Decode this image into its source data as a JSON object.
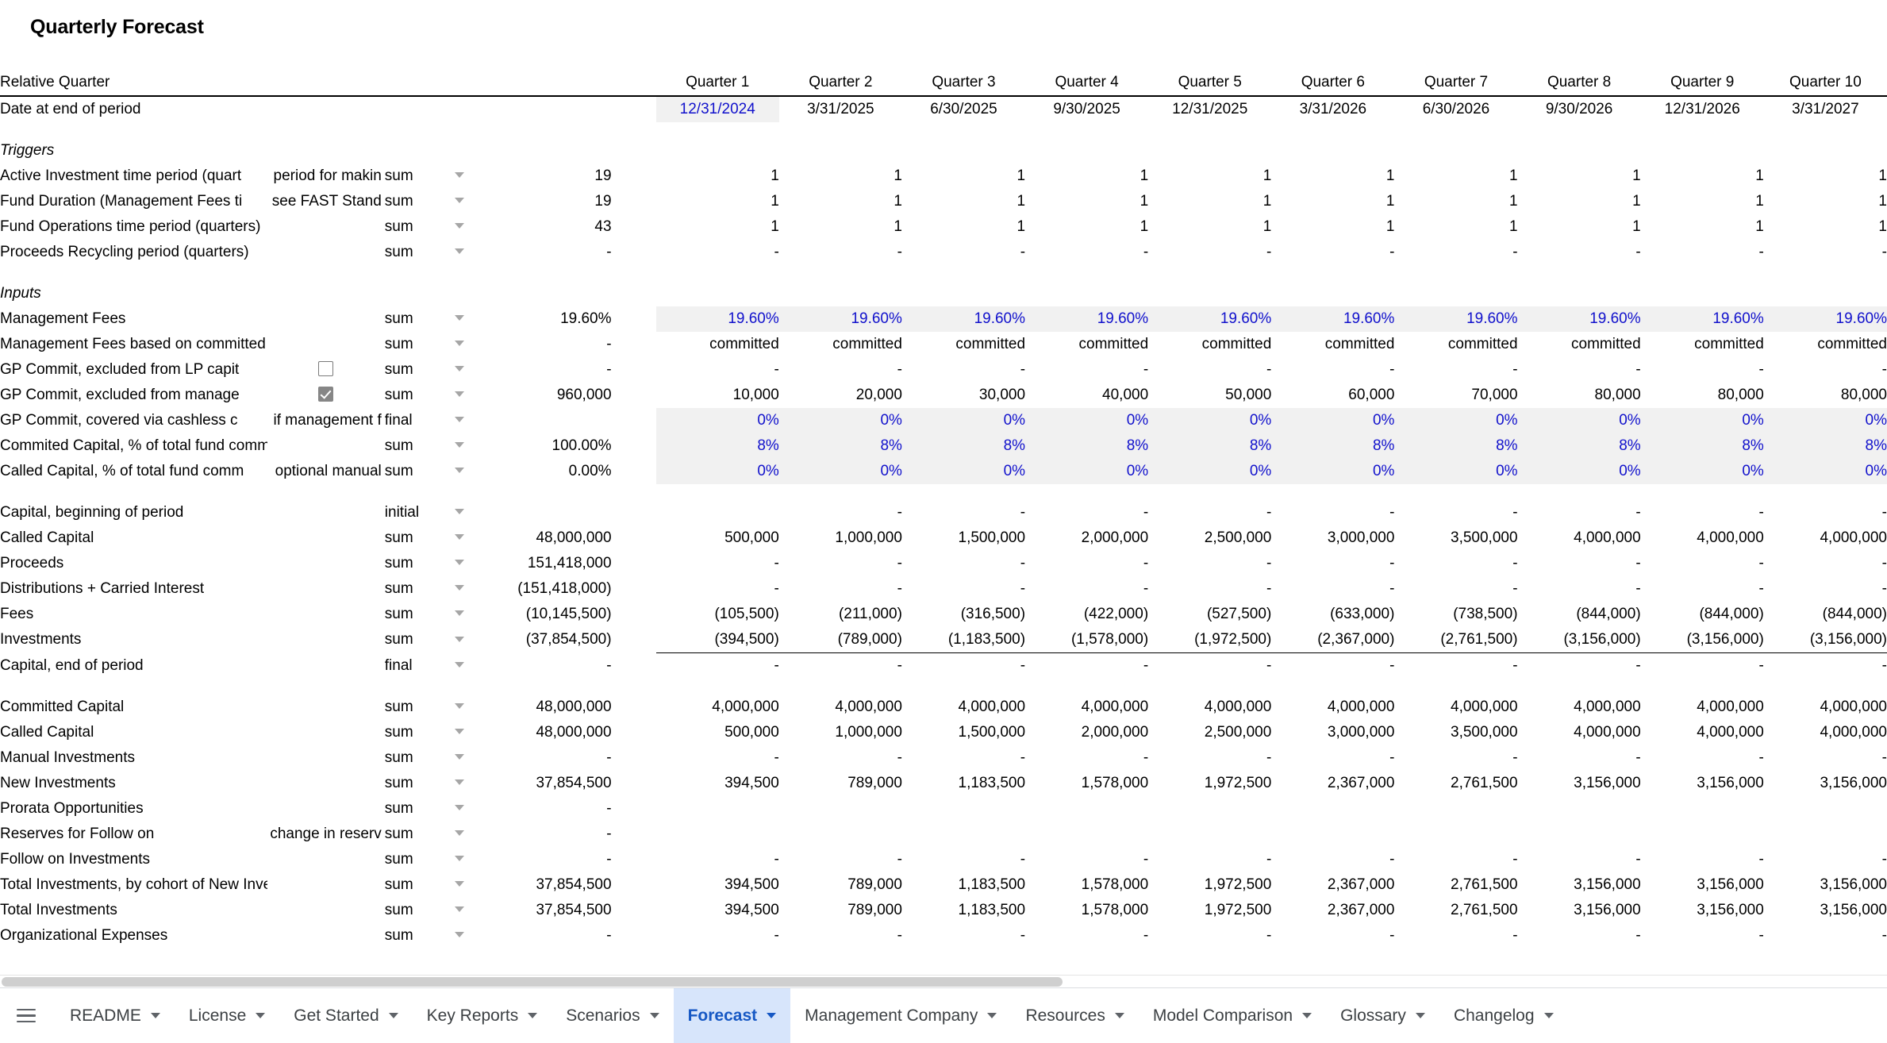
{
  "title": "Quarterly Forecast",
  "columns": {
    "relative_quarter_label": "Relative Quarter",
    "headers": [
      "Quarter 1",
      "Quarter 2",
      "Quarter 3",
      "Quarter 4",
      "Quarter 5",
      "Quarter 6",
      "Quarter 7",
      "Quarter 8",
      "Quarter 9",
      "Quarter 10"
    ]
  },
  "date_row": {
    "label": "Date at end of period",
    "values": [
      "12/31/2024",
      "3/31/2025",
      "6/30/2025",
      "9/30/2025",
      "12/31/2025",
      "3/31/2026",
      "6/30/2026",
      "9/30/2026",
      "12/31/2026",
      "3/31/2027"
    ]
  },
  "sections": {
    "triggers": "Triggers",
    "inputs": "Inputs"
  },
  "rows": {
    "active_investment": {
      "label": "Active Investment time period (quart",
      "note": "period for makin",
      "agg": "sum",
      "total": "19",
      "values": [
        "1",
        "1",
        "1",
        "1",
        "1",
        "1",
        "1",
        "1",
        "1",
        "1"
      ]
    },
    "fund_duration": {
      "label": "Fund Duration (Management Fees ti",
      "note": "see FAST Stand",
      "agg": "sum",
      "total": "19",
      "values": [
        "1",
        "1",
        "1",
        "1",
        "1",
        "1",
        "1",
        "1",
        "1",
        "1"
      ]
    },
    "fund_operations": {
      "label": "Fund Operations time period (quarters)",
      "note": "",
      "agg": "sum",
      "total": "43",
      "values": [
        "1",
        "1",
        "1",
        "1",
        "1",
        "1",
        "1",
        "1",
        "1",
        "1"
      ]
    },
    "proceeds_recycling": {
      "label": "Proceeds Recycling period (quarters)",
      "note": "",
      "agg": "sum",
      "total": "-",
      "values": [
        "-",
        "-",
        "-",
        "-",
        "-",
        "-",
        "-",
        "-",
        "-",
        "-"
      ]
    },
    "management_fees": {
      "label": "Management Fees",
      "note": "",
      "agg": "sum",
      "total": "19.60%",
      "values": [
        "19.60%",
        "19.60%",
        "19.60%",
        "19.60%",
        "19.60%",
        "19.60%",
        "19.60%",
        "19.60%",
        "19.60%",
        "19.60%"
      ]
    },
    "mgmt_fees_basis": {
      "label": "Management Fees based on committed capital. By st",
      "note": "",
      "agg": "sum",
      "total": "-",
      "values": [
        "committed",
        "committed",
        "committed",
        "committed",
        "committed",
        "committed",
        "committed",
        "committed",
        "committed",
        "committed"
      ]
    },
    "gp_commit_lp": {
      "label": "GP Commit, excluded from LP capit",
      "note": "",
      "checkbox": false,
      "agg": "sum",
      "total": "-",
      "values": [
        "-",
        "-",
        "-",
        "-",
        "-",
        "-",
        "-",
        "-",
        "-",
        "-"
      ]
    },
    "gp_commit_mgmt": {
      "label": "GP Commit, excluded from manage",
      "note": "",
      "checkbox": true,
      "agg": "sum",
      "total": "960,000",
      "values": [
        "10,000",
        "20,000",
        "30,000",
        "40,000",
        "50,000",
        "60,000",
        "70,000",
        "80,000",
        "80,000",
        "80,000"
      ]
    },
    "gp_commit_cashless": {
      "label": "GP Commit, covered via cashless c",
      "note": "if management f",
      "agg": "final",
      "total": "",
      "values": [
        "0%",
        "0%",
        "0%",
        "0%",
        "0%",
        "0%",
        "0%",
        "0%",
        "0%",
        "0%"
      ]
    },
    "committed_pct": {
      "label": "Commited Capital, % of total fund committed per yea",
      "note": "",
      "agg": "sum",
      "total": "100.00%",
      "values": [
        "8%",
        "8%",
        "8%",
        "8%",
        "8%",
        "8%",
        "8%",
        "8%",
        "8%",
        "8%"
      ]
    },
    "called_pct": {
      "label": "Called Capital, % of total fund comm",
      "note": "optional manual",
      "agg": "sum",
      "total": "0.00%",
      "values": [
        "0%",
        "0%",
        "0%",
        "0%",
        "0%",
        "0%",
        "0%",
        "0%",
        "0%",
        "0%"
      ]
    },
    "capital_begin": {
      "label": "Capital, beginning of period",
      "note": "",
      "agg": "initial",
      "total": "",
      "values": [
        "",
        "-",
        "-",
        "-",
        "-",
        "-",
        "-",
        "-",
        "-",
        "-"
      ]
    },
    "called_capital_a": {
      "label": "Called Capital",
      "note": "",
      "agg": "sum",
      "total": "48,000,000",
      "values": [
        "500,000",
        "1,000,000",
        "1,500,000",
        "2,000,000",
        "2,500,000",
        "3,000,000",
        "3,500,000",
        "4,000,000",
        "4,000,000",
        "4,000,000"
      ]
    },
    "proceeds": {
      "label": "Proceeds",
      "note": "",
      "agg": "sum",
      "total": "151,418,000",
      "values": [
        "-",
        "-",
        "-",
        "-",
        "-",
        "-",
        "-",
        "-",
        "-",
        "-"
      ]
    },
    "distributions": {
      "label": "Distributions + Carried Interest",
      "note": "",
      "agg": "sum",
      "total": "(151,418,000)",
      "values": [
        "-",
        "-",
        "-",
        "-",
        "-",
        "-",
        "-",
        "-",
        "-",
        "-"
      ]
    },
    "fees": {
      "label": "Fees",
      "note": "",
      "agg": "sum",
      "total": "(10,145,500)",
      "values": [
        "(105,500)",
        "(211,000)",
        "(316,500)",
        "(422,000)",
        "(527,500)",
        "(633,000)",
        "(738,500)",
        "(844,000)",
        "(844,000)",
        "(844,000)"
      ]
    },
    "investments": {
      "label": "Investments",
      "note": "",
      "agg": "sum",
      "total": "(37,854,500)",
      "values": [
        "(394,500)",
        "(789,000)",
        "(1,183,500)",
        "(1,578,000)",
        "(1,972,500)",
        "(2,367,000)",
        "(2,761,500)",
        "(3,156,000)",
        "(3,156,000)",
        "(3,156,000)"
      ]
    },
    "capital_end": {
      "label": "Capital, end of period",
      "note": "",
      "agg": "final",
      "total": "-",
      "values": [
        "-",
        "-",
        "-",
        "-",
        "-",
        "-",
        "-",
        "-",
        "-",
        "-"
      ]
    },
    "committed_capital": {
      "label": "Committed Capital",
      "note": "",
      "agg": "sum",
      "total": "48,000,000",
      "values": [
        "4,000,000",
        "4,000,000",
        "4,000,000",
        "4,000,000",
        "4,000,000",
        "4,000,000",
        "4,000,000",
        "4,000,000",
        "4,000,000",
        "4,000,000"
      ]
    },
    "called_capital_b": {
      "label": "Called Capital",
      "note": "",
      "agg": "sum",
      "total": "48,000,000",
      "values": [
        "500,000",
        "1,000,000",
        "1,500,000",
        "2,000,000",
        "2,500,000",
        "3,000,000",
        "3,500,000",
        "4,000,000",
        "4,000,000",
        "4,000,000"
      ]
    },
    "manual_investments": {
      "label": "Manual Investments",
      "note": "",
      "agg": "sum",
      "total": "-",
      "values": [
        "-",
        "-",
        "-",
        "-",
        "-",
        "-",
        "-",
        "-",
        "-",
        "-"
      ]
    },
    "new_investments": {
      "label": "New Investments",
      "note": "",
      "agg": "sum",
      "total": "37,854,500",
      "values": [
        "394,500",
        "789,000",
        "1,183,500",
        "1,578,000",
        "1,972,500",
        "2,367,000",
        "2,761,500",
        "3,156,000",
        "3,156,000",
        "3,156,000"
      ]
    },
    "prorata": {
      "label": "Prorata Opportunities",
      "note": "",
      "agg": "sum",
      "total": "-",
      "values": [
        "",
        "",
        "",
        "",
        "",
        "",
        "",
        "",
        "",
        ""
      ]
    },
    "reserves": {
      "label": "Reserves for Follow on",
      "note": "change in reserv",
      "agg": "sum",
      "total": "-",
      "values": [
        "",
        "",
        "",
        "",
        "",
        "",
        "",
        "",
        "",
        ""
      ]
    },
    "follow_on": {
      "label": "Follow on Investments",
      "note": "",
      "agg": "sum",
      "total": "-",
      "values": [
        "-",
        "-",
        "-",
        "-",
        "-",
        "-",
        "-",
        "-",
        "-",
        "-"
      ]
    },
    "total_inv_cohort": {
      "label": "Total Investments, by cohort of New Investments",
      "note": "",
      "agg": "sum",
      "total": "37,854,500",
      "values": [
        "394,500",
        "789,000",
        "1,183,500",
        "1,578,000",
        "1,972,500",
        "2,367,000",
        "2,761,500",
        "3,156,000",
        "3,156,000",
        "3,156,000"
      ]
    },
    "total_investments": {
      "label": "Total Investments",
      "note": "",
      "agg": "sum",
      "total": "37,854,500",
      "values": [
        "394,500",
        "789,000",
        "1,183,500",
        "1,578,000",
        "1,972,500",
        "2,367,000",
        "2,761,500",
        "3,156,000",
        "3,156,000",
        "3,156,000"
      ]
    },
    "org_expenses": {
      "label": "Organizational Expenses",
      "note": "",
      "agg": "sum",
      "total": "-",
      "values": [
        "-",
        "-",
        "-",
        "-",
        "-",
        "-",
        "-",
        "-",
        "-",
        "-"
      ]
    }
  },
  "tabs": [
    {
      "label": "README",
      "active": false
    },
    {
      "label": "License",
      "active": false
    },
    {
      "label": "Get Started",
      "active": false
    },
    {
      "label": "Key Reports",
      "active": false
    },
    {
      "label": "Scenarios",
      "active": false
    },
    {
      "label": "Forecast",
      "active": true
    },
    {
      "label": "Management Company",
      "active": false
    },
    {
      "label": "Resources",
      "active": false
    },
    {
      "label": "Model Comparison",
      "active": false
    },
    {
      "label": "Glossary",
      "active": false
    },
    {
      "label": "Changelog",
      "active": false
    }
  ],
  "colors": {
    "accent": "#1658c4",
    "input_blue": "#1111cc",
    "shade": "#f1f1f1",
    "active_tab_bg": "#d7e5fb"
  }
}
